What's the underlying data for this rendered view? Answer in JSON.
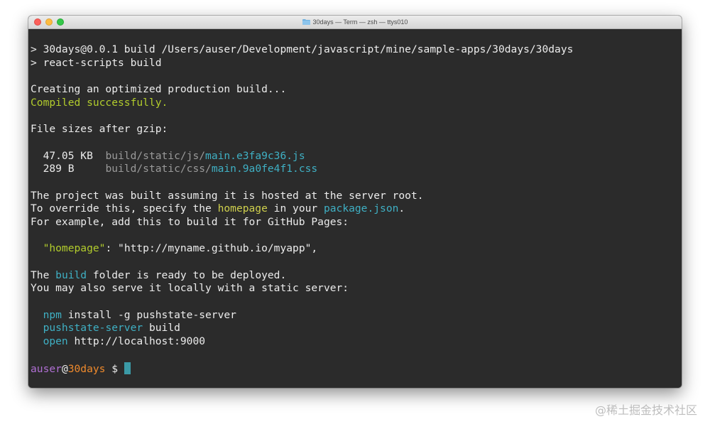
{
  "window": {
    "title": "30days — Term — zsh — ttys010",
    "title_icon": "folder-icon"
  },
  "colors": {
    "background": "#2b2b2b",
    "default_text": "#ececec",
    "success_green": "#b2cc2c",
    "path_gray": "#9a9a9a",
    "cyan": "#3fb0c4",
    "yellow": "#cfd04d",
    "user_purple": "#b06fd4",
    "host_orange": "#ef8a2c",
    "cursor": "#3b9aa6"
  },
  "terminal": {
    "lines": [
      {
        "segments": [
          {
            "text": "> 30days@0.0.1 build /Users/auser/Development/javascript/mine/sample-apps/30days/30days",
            "color": ""
          }
        ]
      },
      {
        "segments": [
          {
            "text": "> react-scripts build",
            "color": ""
          }
        ]
      },
      {
        "segments": []
      },
      {
        "segments": [
          {
            "text": "Creating an optimized production build...",
            "color": ""
          }
        ]
      },
      {
        "segments": [
          {
            "text": "Compiled successfully.",
            "color": "green"
          }
        ]
      },
      {
        "segments": []
      },
      {
        "segments": [
          {
            "text": "File sizes after gzip:",
            "color": ""
          }
        ]
      },
      {
        "segments": []
      },
      {
        "segments": [
          {
            "text": "  47.05 KB  ",
            "color": ""
          },
          {
            "text": "build/static/js/",
            "color": "gray"
          },
          {
            "text": "main.e3fa9c36.js",
            "color": "cyan"
          }
        ]
      },
      {
        "segments": [
          {
            "text": "  289 B     ",
            "color": ""
          },
          {
            "text": "build/static/css/",
            "color": "gray"
          },
          {
            "text": "main.9a0fe4f1.css",
            "color": "cyan"
          }
        ]
      },
      {
        "segments": []
      },
      {
        "segments": [
          {
            "text": "The project was built assuming it is hosted at the server root.",
            "color": ""
          }
        ]
      },
      {
        "segments": [
          {
            "text": "To override this, specify the ",
            "color": ""
          },
          {
            "text": "homepage",
            "color": "yellow"
          },
          {
            "text": " in your ",
            "color": ""
          },
          {
            "text": "package.json",
            "color": "cyan"
          },
          {
            "text": ".",
            "color": ""
          }
        ]
      },
      {
        "segments": [
          {
            "text": "For example, add this to build it for GitHub Pages:",
            "color": ""
          }
        ]
      },
      {
        "segments": []
      },
      {
        "segments": [
          {
            "text": "  ",
            "color": ""
          },
          {
            "text": "\"homepage\"",
            "color": "green"
          },
          {
            "text": ": ",
            "color": ""
          },
          {
            "text": "\"http://myname.github.io/myapp\"",
            "color": ""
          },
          {
            "text": ",",
            "color": ""
          }
        ]
      },
      {
        "segments": []
      },
      {
        "segments": [
          {
            "text": "The ",
            "color": ""
          },
          {
            "text": "build",
            "color": "cyan"
          },
          {
            "text": " folder is ready to be deployed.",
            "color": ""
          }
        ]
      },
      {
        "segments": [
          {
            "text": "You may also serve it locally with a static server:",
            "color": ""
          }
        ]
      },
      {
        "segments": []
      },
      {
        "segments": [
          {
            "text": "  ",
            "color": ""
          },
          {
            "text": "npm",
            "color": "cyan"
          },
          {
            "text": " install -g pushstate-server",
            "color": ""
          }
        ]
      },
      {
        "segments": [
          {
            "text": "  ",
            "color": ""
          },
          {
            "text": "pushstate-server",
            "color": "cyan"
          },
          {
            "text": " build",
            "color": ""
          }
        ]
      },
      {
        "segments": [
          {
            "text": "  ",
            "color": ""
          },
          {
            "text": "open",
            "color": "cyan"
          },
          {
            "text": " http://localhost:9000",
            "color": ""
          }
        ]
      },
      {
        "segments": []
      }
    ],
    "prompt": {
      "user": "auser",
      "at": "@",
      "host": "30days",
      "symbol": " $ "
    }
  },
  "watermark": "@稀土掘金技术社区"
}
